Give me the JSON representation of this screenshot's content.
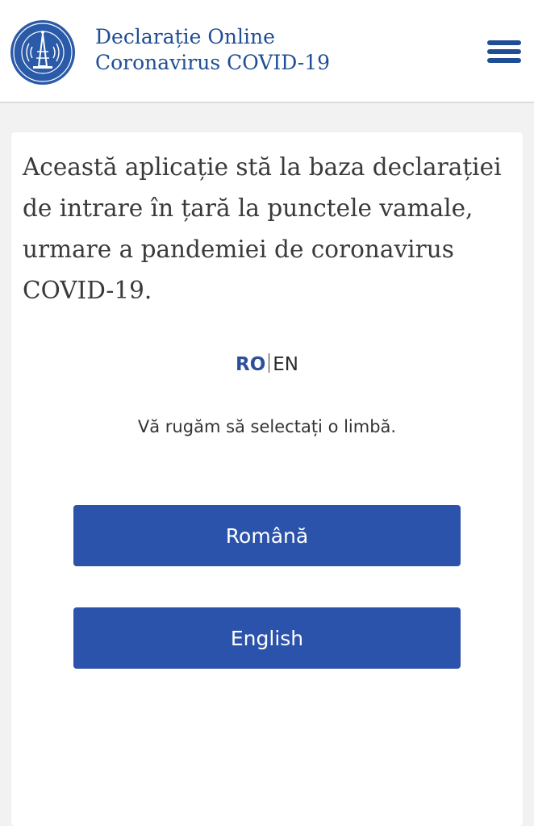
{
  "header": {
    "title_line1": "Declarație Online",
    "title_line2": "Coronavirus COVID-19",
    "logo_icon": "government-seal-logo",
    "menu_icon": "hamburger-menu-icon"
  },
  "main": {
    "intro_text": "Această aplicație stă la baza declarației de intrare în țară la punctele vamale, urmare a pandemiei de coronavirus COVID-19.",
    "lang_switch": {
      "ro": "RO",
      "en": "EN",
      "active": "RO"
    },
    "prompt": "Vă rugăm să selectați o limbă.",
    "buttons": {
      "romanian": "Română",
      "english": "English"
    }
  },
  "colors": {
    "brand_blue": "#1f4e94",
    "button_blue": "#2c53ab",
    "background": "#f2f2f2"
  }
}
